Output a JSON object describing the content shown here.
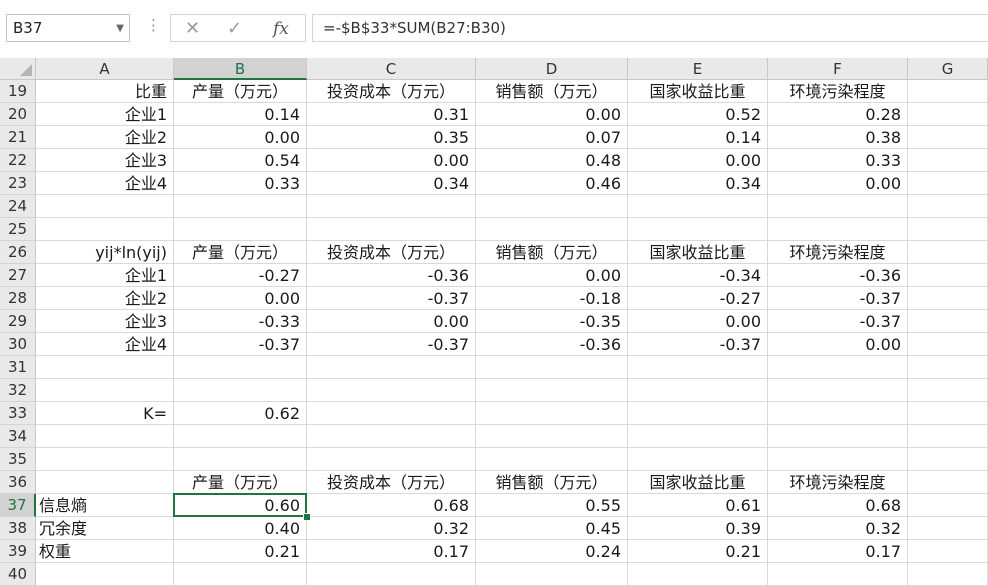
{
  "name_box": "B37",
  "formula": "=-$B$33*SUM(B27:B30)",
  "columns": [
    "A",
    "B",
    "C",
    "D",
    "E",
    "F",
    "G"
  ],
  "selected_column": "B",
  "selected_row": "37",
  "rows": [
    {
      "n": "19",
      "cells": [
        "比重",
        "产量（万元）",
        "投资成本（万元）",
        "销售额（万元）",
        "国家收益比重",
        "环境污染程度",
        ""
      ]
    },
    {
      "n": "20",
      "cells": [
        "企业1",
        "0.14",
        "0.31",
        "0.00",
        "0.52",
        "0.28",
        ""
      ]
    },
    {
      "n": "21",
      "cells": [
        "企业2",
        "0.00",
        "0.35",
        "0.07",
        "0.14",
        "0.38",
        ""
      ]
    },
    {
      "n": "22",
      "cells": [
        "企业3",
        "0.54",
        "0.00",
        "0.48",
        "0.00",
        "0.33",
        ""
      ]
    },
    {
      "n": "23",
      "cells": [
        "企业4",
        "0.33",
        "0.34",
        "0.46",
        "0.34",
        "0.00",
        ""
      ]
    },
    {
      "n": "24",
      "cells": [
        "",
        "",
        "",
        "",
        "",
        "",
        ""
      ]
    },
    {
      "n": "25",
      "cells": [
        "",
        "",
        "",
        "",
        "",
        "",
        ""
      ]
    },
    {
      "n": "26",
      "cells": [
        "yij*ln(yij)",
        "产量（万元）",
        "投资成本（万元）",
        "销售额（万元）",
        "国家收益比重",
        "环境污染程度",
        ""
      ]
    },
    {
      "n": "27",
      "cells": [
        "企业1",
        "-0.27",
        "-0.36",
        "0.00",
        "-0.34",
        "-0.36",
        ""
      ]
    },
    {
      "n": "28",
      "cells": [
        "企业2",
        "0.00",
        "-0.37",
        "-0.18",
        "-0.27",
        "-0.37",
        ""
      ]
    },
    {
      "n": "29",
      "cells": [
        "企业3",
        "-0.33",
        "0.00",
        "-0.35",
        "0.00",
        "-0.37",
        ""
      ]
    },
    {
      "n": "30",
      "cells": [
        "企业4",
        "-0.37",
        "-0.37",
        "-0.36",
        "-0.37",
        "0.00",
        ""
      ]
    },
    {
      "n": "31",
      "cells": [
        "",
        "",
        "",
        "",
        "",
        "",
        ""
      ]
    },
    {
      "n": "32",
      "cells": [
        "",
        "",
        "",
        "",
        "",
        "",
        ""
      ]
    },
    {
      "n": "33",
      "cells": [
        "K=",
        "0.62",
        "",
        "",
        "",
        "",
        ""
      ]
    },
    {
      "n": "34",
      "cells": [
        "",
        "",
        "",
        "",
        "",
        "",
        ""
      ]
    },
    {
      "n": "35",
      "cells": [
        "",
        "",
        "",
        "",
        "",
        "",
        ""
      ]
    },
    {
      "n": "36",
      "cells": [
        "",
        "产量（万元）",
        "投资成本（万元）",
        "销售额（万元）",
        "国家收益比重",
        "环境污染程度",
        ""
      ]
    },
    {
      "n": "37",
      "cells": [
        "信息熵",
        "0.60",
        "0.68",
        "0.55",
        "0.61",
        "0.68",
        ""
      ]
    },
    {
      "n": "38",
      "cells": [
        "冗余度",
        "0.40",
        "0.32",
        "0.45",
        "0.39",
        "0.32",
        ""
      ]
    },
    {
      "n": "39",
      "cells": [
        "权重",
        "0.21",
        "0.17",
        "0.24",
        "0.21",
        "0.17",
        ""
      ]
    },
    {
      "n": "40",
      "cells": [
        "",
        "",
        "",
        "",
        "",
        "",
        ""
      ]
    }
  ],
  "left_aligned_label_rows": [
    "37",
    "38",
    "39"
  ]
}
